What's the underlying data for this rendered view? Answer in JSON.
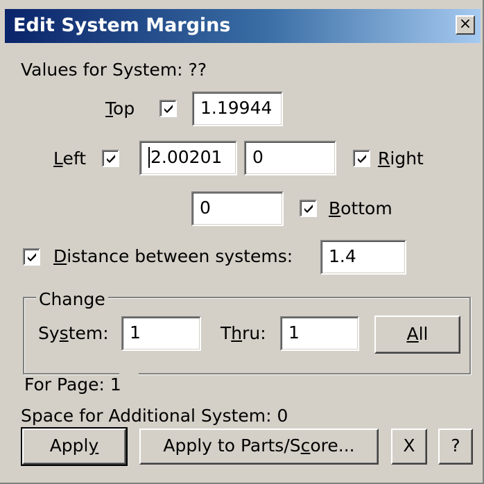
{
  "window": {
    "title": "Edit System Margins",
    "close_label": "×"
  },
  "values_for_system": {
    "label": "Values for System:",
    "value": "??"
  },
  "top": {
    "label_first": "T",
    "label_rest": "op",
    "checked": true,
    "value": "1.19944"
  },
  "left": {
    "label_first": "L",
    "label_rest": "eft",
    "checked": true,
    "value": "2.00201"
  },
  "right": {
    "label_first": "R",
    "label_rest": "ight",
    "checked": true,
    "value": "0"
  },
  "bottom": {
    "label_first": "B",
    "label_rest": "ottom",
    "checked": true,
    "value": "0"
  },
  "distance": {
    "label_first": "D",
    "label_rest": "istance between systems:",
    "checked": true,
    "value": "1.4"
  },
  "change": {
    "legend": "Change",
    "system_label_a": "Sy",
    "system_label_u": "s",
    "system_label_b": "tem:",
    "system_value": "1",
    "thru_label_a": "T",
    "thru_label_u": "h",
    "thru_label_b": "ru:",
    "thru_value": "1",
    "all_label": "A",
    "all_rest": "ll"
  },
  "for_page": {
    "label": "For Page:",
    "value": "1"
  },
  "additional": {
    "label": "Space for Additional System:",
    "value": "0"
  },
  "buttons": {
    "apply_a": "Appl",
    "apply_u": "y",
    "apply_parts_a": "Apply to Parts/S",
    "apply_parts_u": "c",
    "apply_parts_b": "ore...",
    "cancel": "X",
    "help": "?"
  }
}
